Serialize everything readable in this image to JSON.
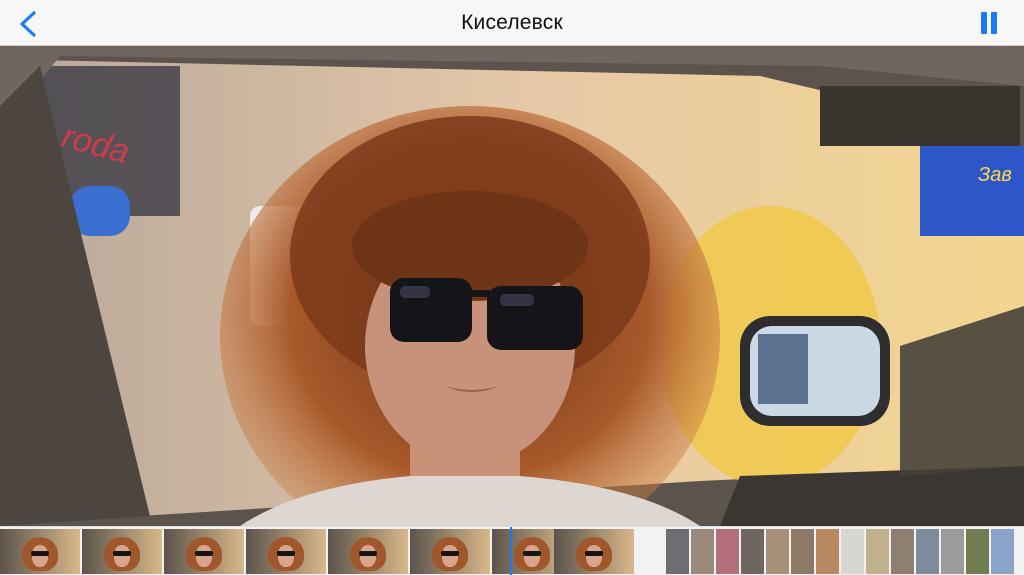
{
  "navbar": {
    "title": "Киселевск",
    "back_icon": "chevron-left-icon",
    "pause_icon": "pause-icon",
    "accent_color": "#1a7cf5"
  },
  "viewer": {
    "description_icon": "video-frame"
  },
  "filmstrip": {
    "playhead_icon": "playhead-marker"
  }
}
